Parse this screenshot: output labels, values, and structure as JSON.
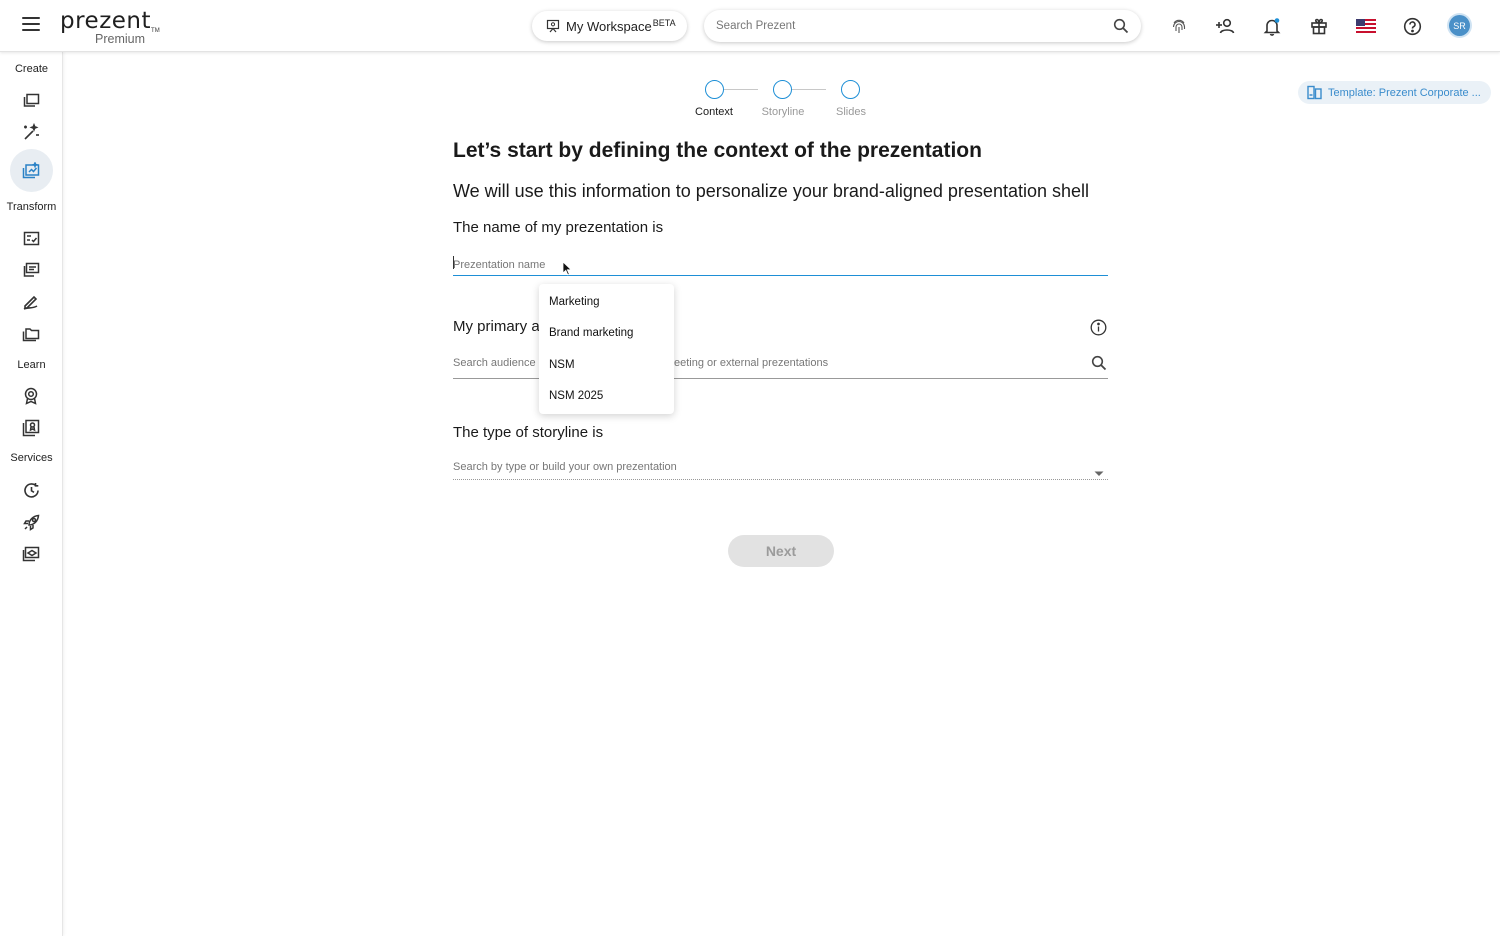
{
  "header": {
    "brand": "prezent",
    "brand_tm": "TM",
    "plan": "Premium",
    "workspace_label": "My Workspace",
    "workspace_badge": "BETA",
    "search_placeholder": "Search Prezent",
    "avatar_initials": "SR"
  },
  "sidebar": {
    "sections": [
      "Create",
      "Transform",
      "Learn",
      "Services"
    ]
  },
  "stepper": {
    "steps": [
      "Context",
      "Storyline",
      "Slides"
    ],
    "active_color": "#1e8fd6"
  },
  "template_chip": "Template: Prezent Corporate ...",
  "main": {
    "title": "Let’s start by defining the context of the prezentation",
    "subtitle": "We will use this information to personalize your brand-aligned presentation shell",
    "name_label": "The name of my prezentation is",
    "name_placeholder": "Prezentation name",
    "audience_label_visible": "My primary a",
    "audience_placeholder_left": "Search audience b",
    "audience_placeholder_right": "eeting or external prezentations",
    "storyline_label": "The type of storyline is",
    "storyline_placeholder": "Search by type or build your own prezentation",
    "next_label": "Next"
  },
  "suggestions": [
    "Marketing",
    "Brand marketing",
    "NSM",
    "NSM 2025"
  ]
}
